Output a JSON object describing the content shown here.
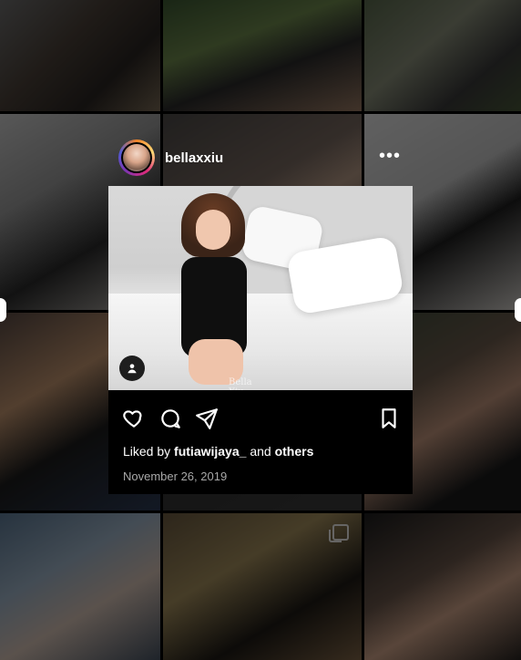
{
  "post": {
    "username": "bellaxxiu",
    "more_icon": "more-horizontal-icon",
    "photo_signature": "Bella Xiu",
    "actions": {
      "like_icon": "heart-icon",
      "comment_icon": "comment-icon",
      "share_icon": "send-icon",
      "save_icon": "bookmark-icon",
      "tag_icon": "person-icon"
    },
    "likes_prefix": "Liked by",
    "likes_user": "futiawijaya_",
    "likes_joiner": "and",
    "likes_suffix": "others",
    "date": "November 26, 2019"
  },
  "grid": {
    "multi_photo_icon": "carousel-icon"
  },
  "colors": {
    "background": "#000000",
    "text": "#ffffff",
    "secondary_text": "#a8a8a8"
  }
}
